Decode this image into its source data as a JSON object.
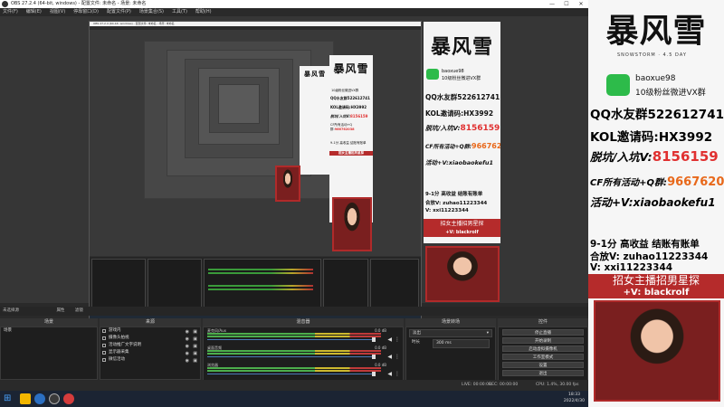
{
  "window": {
    "title": "OBS 27.2.4 (64-bit, windows) - 配置文件: 未命名 - 场景: 未命名",
    "controls": [
      "—",
      "☐",
      "✕"
    ]
  },
  "menu": [
    "文件(F)",
    "编辑(E)",
    "视图(V)",
    "停靠窗口(D)",
    "配置文件(P)",
    "场景集合(S)",
    "工具(T)",
    "帮助(H)"
  ],
  "inner_title": "OBS 27.2.4 (64-bit, windows) - 配置文件: 未命名 - 场景: 未命名",
  "overlay": {
    "logo": "暴风雪",
    "logo_sub": "SNOWSTORM · 4.5 DAY",
    "wechat_id": "baoxue98",
    "wechat_desc": "10级粉丝微进VX群",
    "qq_group": "QQ水友群522612741",
    "kol_code": "KOL邀请码:HX3992",
    "keng_label": "脱坑/入坑V:",
    "keng_value": "8156159",
    "cf_label": "CF所有活动+Q群:",
    "cf_value": "966762038",
    "act_label": "活动+V:",
    "act_value": "xiaobaokefu1",
    "job1": "9-1分 高收益 结账有账单",
    "job2": "合放V: zuhao11223344",
    "job3": "V: xxi11223344",
    "recruit": "招女主播招男星探",
    "recruit_v": "+V: blackrolf"
  },
  "docks": {
    "scenes": {
      "header": "场景",
      "items": [
        "场景"
      ]
    },
    "sources": {
      "header": "来源",
      "items": [
        "游戏内",
        "摄像头拍视",
        "活动推广文字说明",
        "显示器采集",
        "微信活动"
      ]
    },
    "mixer": {
      "header": "混音器",
      "channels": [
        {
          "name": "麦克风/Aux",
          "db": "0.0 dB"
        },
        {
          "name": "桌面音频",
          "db": "0.0 dB"
        },
        {
          "name": "浏览器",
          "db": "0.0 dB"
        }
      ]
    },
    "transitions": {
      "header": "场景转场",
      "type": "淡出",
      "duration_label": "时长",
      "duration": "300 ms"
    },
    "controls": {
      "header": "控件",
      "buttons": [
        "停止直播",
        "开始录制",
        "启动虚拟摄像机",
        "工作室模式",
        "设置",
        "退出"
      ]
    }
  },
  "toolbar": {
    "studio_label": "未选择源",
    "properties": "属性",
    "filters": "滤镜"
  },
  "status": {
    "live": "LIVE: 00:00:00",
    "rec": "REC: 00:00:00",
    "cpu": "CPU: 1.4%, 30.00 fps"
  },
  "clock": {
    "time": "18:33",
    "date": "2022/4/30"
  }
}
